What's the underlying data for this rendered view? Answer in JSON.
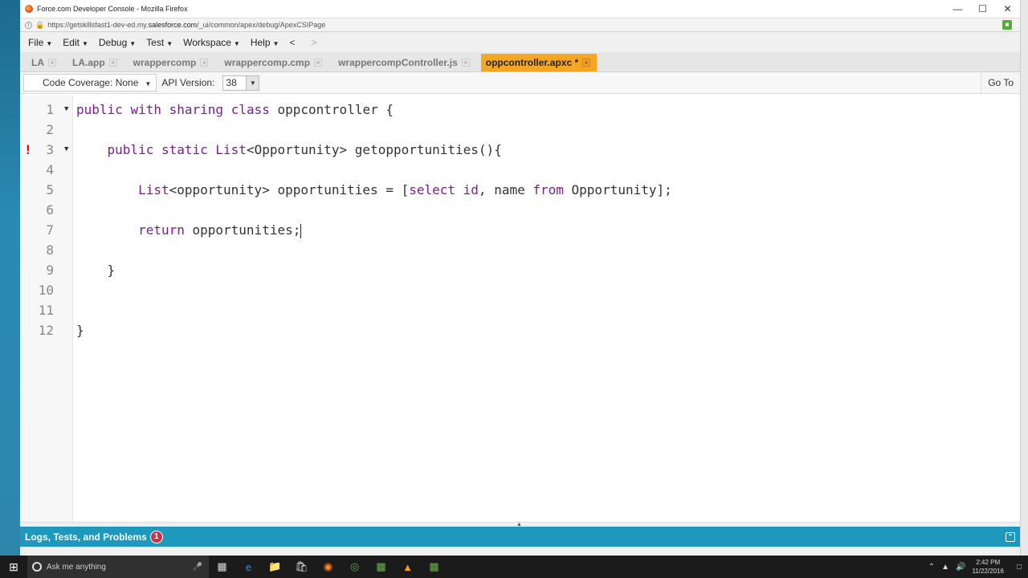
{
  "browser": {
    "title": "Force.com Developer Console - Mozilla Firefox",
    "url_prefix": "https://getskillsfast1-dev-ed.my.",
    "url_domain": "salesforce.com",
    "url_suffix": "/_ui/common/apex/debug/ApexCSIPage"
  },
  "menu": {
    "items": [
      "File",
      "Edit",
      "Debug",
      "Test",
      "Workspace",
      "Help"
    ],
    "back": "<",
    "forward": ">"
  },
  "tabs": [
    {
      "label": "LA"
    },
    {
      "label": "LA.app"
    },
    {
      "label": "wrappercomp"
    },
    {
      "label": "wrappercomp.cmp"
    },
    {
      "label": "wrappercompController.js"
    },
    {
      "label": "oppcontroller.apxc *"
    }
  ],
  "toolbar": {
    "coverage": "Code Coverage: None",
    "api_label": "API Version:",
    "api_value": "38",
    "goto": "Go To"
  },
  "editor": {
    "line_numbers": [
      "1",
      "2",
      "3",
      "4",
      "5",
      "6",
      "7",
      "8",
      "9",
      "10",
      "11",
      "12"
    ],
    "error_marker": "!"
  },
  "bottom_panel": {
    "label": "Logs, Tests, and Problems",
    "problem_count": "1"
  },
  "taskbar": {
    "search_placeholder": "Ask me anything",
    "time": "2:42 PM",
    "date": "11/22/2016"
  }
}
